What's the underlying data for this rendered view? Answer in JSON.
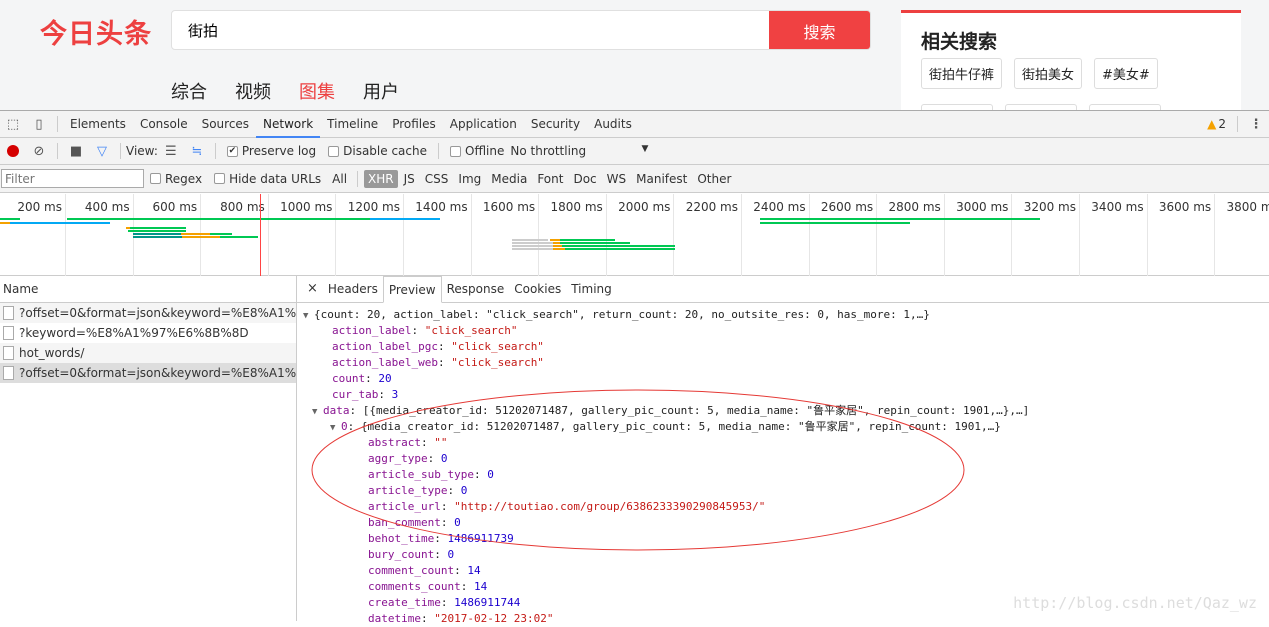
{
  "site": {
    "logo": "今日头条",
    "search_value": "街拍",
    "search_button": "搜索",
    "nav": [
      "综合",
      "视频",
      "图集",
      "用户"
    ],
    "active_nav": 2,
    "related_title": "相关搜索",
    "related_tags": [
      "街拍牛仔裤",
      "街拍美女",
      "#美女#"
    ]
  },
  "devtools": {
    "tabs": [
      "Elements",
      "Console",
      "Sources",
      "Network",
      "Timeline",
      "Profiles",
      "Application",
      "Security",
      "Audits"
    ],
    "active_tab": "Network",
    "warnings": "2",
    "toolbar": {
      "view_label": "View:",
      "preserve_log": "Preserve log",
      "preserve_checked": true,
      "disable_cache": "Disable cache",
      "offline": "Offline",
      "throttling": "No throttling"
    },
    "filter": {
      "placeholder": "Filter",
      "regex": "Regex",
      "hide_data_urls": "Hide data URLs",
      "types": [
        "All",
        "XHR",
        "JS",
        "CSS",
        "Img",
        "Media",
        "Font",
        "Doc",
        "WS",
        "Manifest",
        "Other"
      ],
      "active_type": "XHR"
    },
    "timeline_ticks": [
      "200 ms",
      "400 ms",
      "600 ms",
      "800 ms",
      "1000 ms",
      "1200 ms",
      "1400 ms",
      "1600 ms",
      "1800 ms",
      "2000 ms",
      "2200 ms",
      "2400 ms",
      "2600 ms",
      "2800 ms",
      "3000 ms",
      "3200 ms",
      "3400 ms",
      "3600 ms",
      "3800 ms"
    ],
    "requests_header": "Name",
    "requests": [
      "?offset=0&format=json&keyword=%E8%A1%97%...",
      "?keyword=%E8%A1%97%E6%8B%8D",
      "hot_words/",
      "?offset=0&format=json&keyword=%E8%A1%97%..."
    ],
    "selected_request": 3,
    "detail_tabs": [
      "Headers",
      "Preview",
      "Response",
      "Cookies",
      "Timing"
    ],
    "active_detail_tab": "Preview",
    "preview": [
      {
        "indent": 0,
        "tri": "▼",
        "text": "{count: 20, action_label: \"click_search\", return_count: 20, no_outsite_res: 0, has_more: 1,…}"
      },
      {
        "indent": 1,
        "key": "action_label",
        "value": "\"click_search\"",
        "type": "s"
      },
      {
        "indent": 1,
        "key": "action_label_pgc",
        "value": "\"click_search\"",
        "type": "s"
      },
      {
        "indent": 1,
        "key": "action_label_web",
        "value": "\"click_search\"",
        "type": "s"
      },
      {
        "indent": 1,
        "key": "count",
        "value": "20",
        "type": "n"
      },
      {
        "indent": 1,
        "key": "cur_tab",
        "value": "3",
        "type": "n"
      },
      {
        "indent": 0.5,
        "tri": "▼",
        "key": "data",
        "value": "[{media_creator_id: 51202071487, gallery_pic_count: 5, media_name: \"鲁平家居\", repin_count: 1901,…},…]",
        "type": "p"
      },
      {
        "indent": 1.5,
        "tri": "▼",
        "key": "0",
        "value": "{media_creator_id: 51202071487, gallery_pic_count: 5, media_name: \"鲁平家居\", repin_count: 1901,…}",
        "type": "p"
      },
      {
        "indent": 3,
        "key": "abstract",
        "value": "\"\"",
        "type": "s"
      },
      {
        "indent": 3,
        "key": "aggr_type",
        "value": "0",
        "type": "n"
      },
      {
        "indent": 3,
        "key": "article_sub_type",
        "value": "0",
        "type": "n"
      },
      {
        "indent": 3,
        "key": "article_type",
        "value": "0",
        "type": "n"
      },
      {
        "indent": 3,
        "key": "article_url",
        "value": "\"http://toutiao.com/group/6386233390290845953/\"",
        "type": "s"
      },
      {
        "indent": 3,
        "key": "ban_comment",
        "value": "0",
        "type": "n"
      },
      {
        "indent": 3,
        "key": "behot_time",
        "value": "1486911739",
        "type": "n"
      },
      {
        "indent": 3,
        "key": "bury_count",
        "value": "0",
        "type": "n"
      },
      {
        "indent": 3,
        "key": "comment_count",
        "value": "14",
        "type": "n"
      },
      {
        "indent": 3,
        "key": "comments_count",
        "value": "14",
        "type": "n"
      },
      {
        "indent": 3,
        "key": "create_time",
        "value": "1486911744",
        "type": "n"
      },
      {
        "indent": 3,
        "key": "datetime",
        "value": "\"2017-02-12 23:02\"",
        "type": "s"
      }
    ]
  },
  "watermark": "http://blog.csdn.net/Qaz_wz",
  "colors": {
    "brand": "#ed4040",
    "annotation": "#e53935"
  }
}
